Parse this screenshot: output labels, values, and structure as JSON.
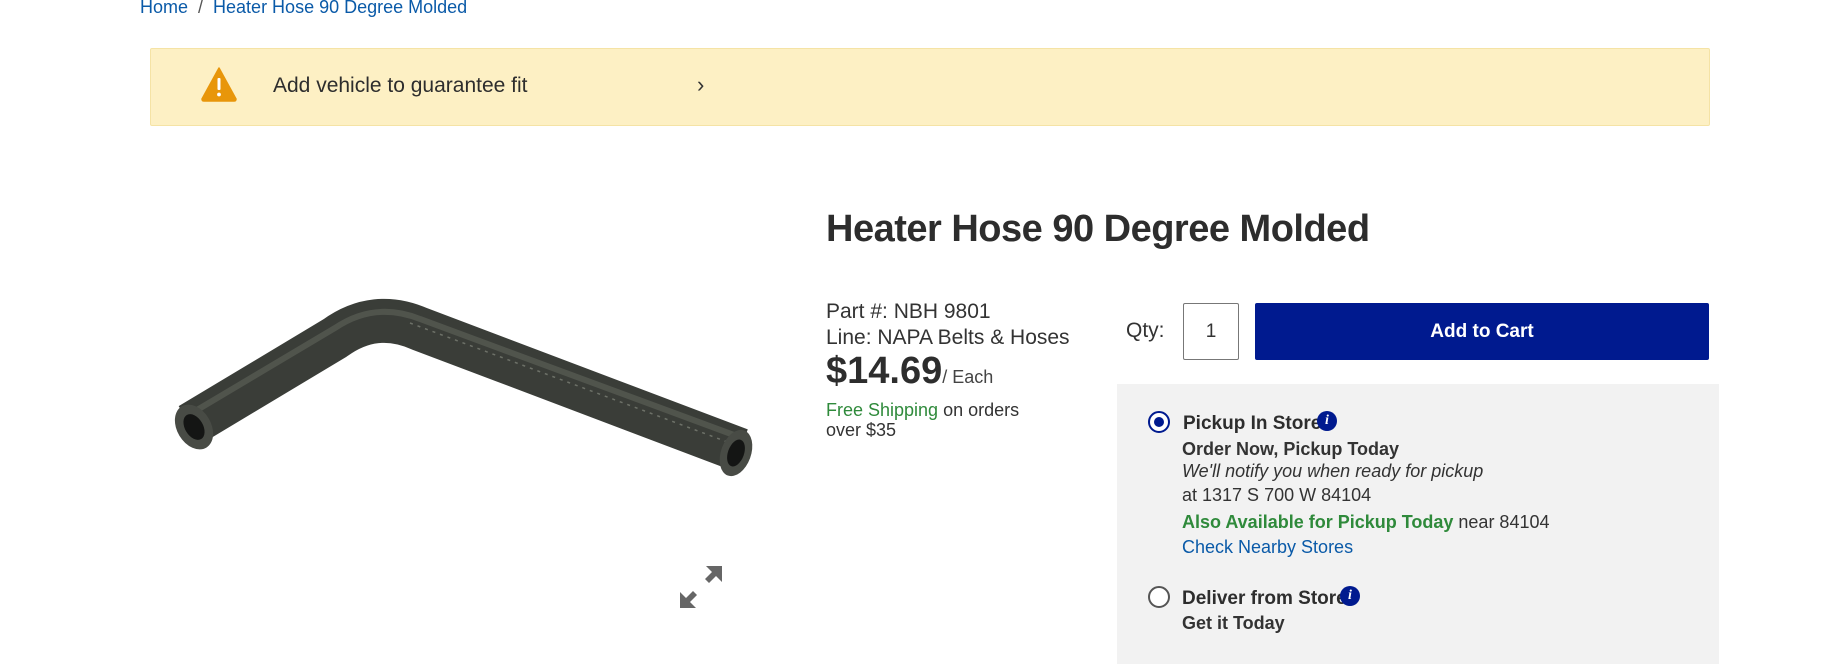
{
  "breadcrumb": {
    "home": "Home",
    "separator": "/",
    "current": "Heater Hose 90 Degree Molded"
  },
  "vehicle_banner": {
    "icon": "warning-icon",
    "text": "Add vehicle to guarantee fit",
    "chevron": "›"
  },
  "product": {
    "title": "Heater Hose 90 Degree Molded",
    "part_label": "Part #: NBH 9801",
    "line_label": "Line: NAPA Belts & Hoses",
    "price": "$14.69",
    "price_unit": "/ Each",
    "free_shipping": "Free Shipping",
    "shipping_terms": " on orders over $35"
  },
  "purchase": {
    "qty_label": "Qty:",
    "qty_value": "1",
    "add_to_cart": "Add to Cart"
  },
  "fulfillment": {
    "pickup": {
      "title": "Pickup In Store",
      "selected": true,
      "headline": "Order Now, Pickup Today",
      "notify": "We'll notify you when ready for pickup",
      "address": "at 1317 S 700 W 84104",
      "also_available": "Also Available for Pickup Today",
      "near": " near 84104",
      "check_stores": "Check Nearby Stores"
    },
    "deliver": {
      "title": "Deliver from Store",
      "selected": false,
      "headline": "Get it Today"
    }
  },
  "colors": {
    "brand_blue": "#001a8f",
    "success_green": "#2f8a3b",
    "link_blue": "#0a5aa8",
    "banner_bg": "#fdf0c4"
  }
}
